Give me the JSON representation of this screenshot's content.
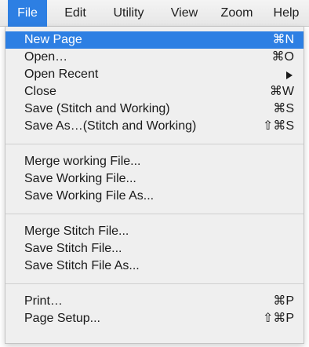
{
  "menubar": {
    "items": [
      {
        "label": "File"
      },
      {
        "label": "Edit"
      },
      {
        "label": "Utility"
      },
      {
        "label": "View"
      },
      {
        "label": "Zoom"
      },
      {
        "label": "Help"
      }
    ],
    "active_index": 0
  },
  "file_menu": {
    "items": [
      {
        "label": "New Page",
        "shortcut": "⌘N",
        "highlighted": true
      },
      {
        "label": "Open…",
        "shortcut": "⌘O"
      },
      {
        "label": "Open Recent",
        "submenu": true
      },
      {
        "label": "Close",
        "shortcut": "⌘W"
      },
      {
        "label": "Save (Stitch and Working)",
        "shortcut": "⌘S"
      },
      {
        "label": "Save As…(Stitch and Working)",
        "shortcut": "⇧⌘S"
      },
      {
        "label": "Merge working File..."
      },
      {
        "label": "Save Working File..."
      },
      {
        "label": "Save Working File As..."
      },
      {
        "label": "Merge Stitch File..."
      },
      {
        "label": "Save Stitch File..."
      },
      {
        "label": "Save Stitch File As..."
      },
      {
        "label": "Print…",
        "shortcut": "⌘P"
      },
      {
        "label": "Page Setup...",
        "shortcut": "⇧⌘P"
      }
    ]
  },
  "colors": {
    "highlight": "#2d7fe3",
    "menu_background": "#efefef",
    "menubar_background": "#eeeeee",
    "text": "#1a1a1a"
  }
}
